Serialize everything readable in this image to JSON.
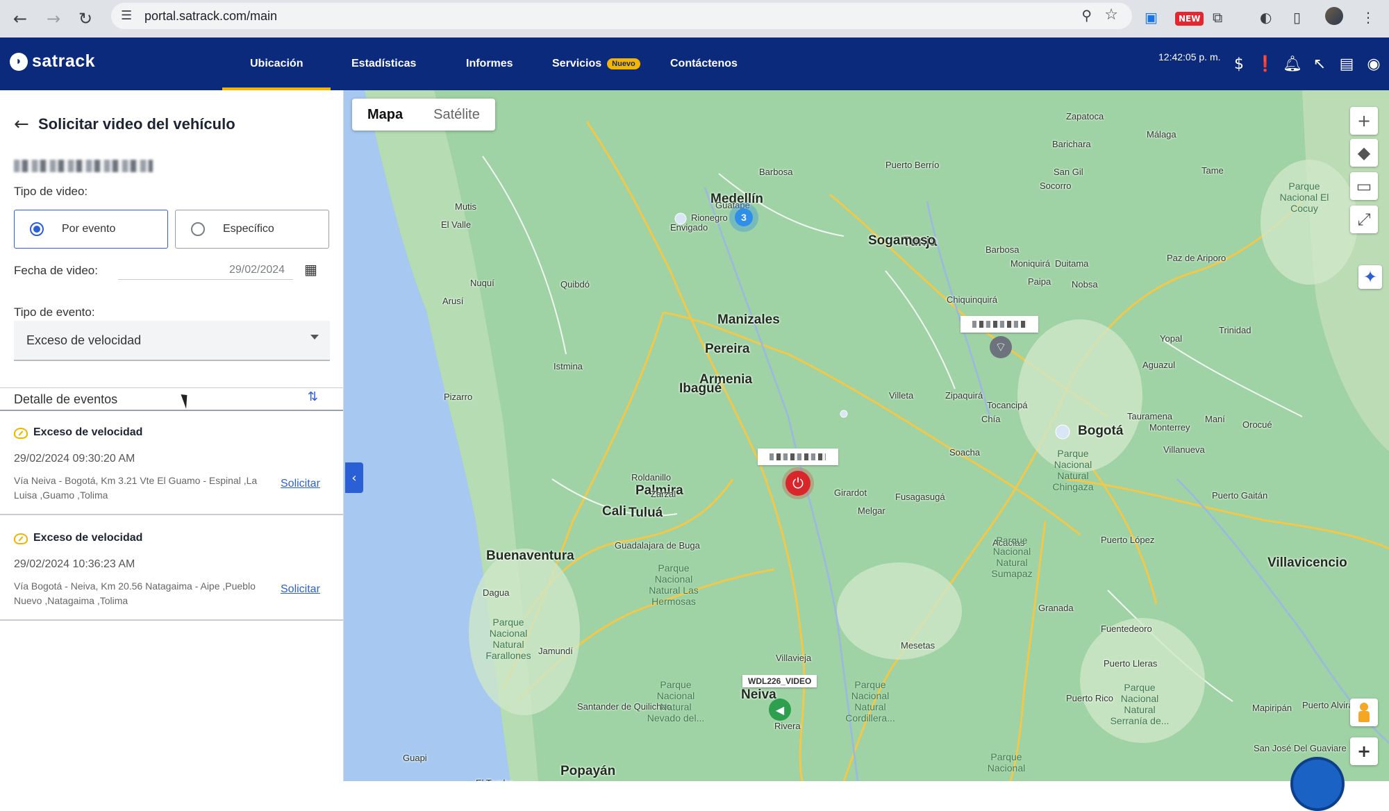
{
  "browser": {
    "url": "portal.satrack.com/main",
    "new_badge": "NEW"
  },
  "app": {
    "logo": "satrack",
    "menu": [
      {
        "label": "Ubicación"
      },
      {
        "label": "Estadísticas"
      },
      {
        "label": "Informes"
      },
      {
        "label": "Servicios",
        "badge": "Nuevo"
      },
      {
        "label": "Contáctenos"
      }
    ],
    "clock": "12:42:05 p. m.",
    "accent": "#f5b400",
    "header_color": "#0b2a7c"
  },
  "panel": {
    "title": "Solicitar video del vehículo",
    "video_type_label": "Tipo de video:",
    "option_event": "Por evento",
    "option_specific": "Específico",
    "date_label": "Fecha de video:",
    "date_value": "29/02/2024",
    "event_type_label": "Tipo de evento:",
    "event_type_value": "Exceso de velocidad",
    "details_title": "Detalle de eventos",
    "events": [
      {
        "name": "Exceso de velocidad",
        "datetime": "29/02/2024 09:30:20 AM",
        "address": "Vía Neiva - Bogotá, Km 3.21 Vte El Guamo - Espinal ,La Luisa ,Guamo ,Tolima",
        "action": "Solicitar"
      },
      {
        "name": "Exceso de velocidad",
        "datetime": "29/02/2024 10:36:23 AM",
        "address": "Vía Bogotá - Neiva, Km 20.56 Natagaima - Aipe ,Pueblo Nuevo ,Natagaima ,Tolima",
        "action": "Solicitar"
      }
    ]
  },
  "map": {
    "type_map": "Mapa",
    "type_satellite": "Satélite",
    "cluster_count": "3",
    "vehicle_label_green": "WDL226_VIDEO",
    "cities": [
      {
        "name": "Medellín",
        "size": "big"
      },
      {
        "name": "Bogotá",
        "size": "big"
      },
      {
        "name": "Manizales",
        "size": "big"
      },
      {
        "name": "Pereira",
        "size": "big"
      },
      {
        "name": "Armenia",
        "size": "big"
      },
      {
        "name": "Ibagué",
        "size": "big"
      },
      {
        "name": "Tunja",
        "size": "big"
      },
      {
        "name": "Sogamoso",
        "size": "big"
      },
      {
        "name": "Villavicencio",
        "size": "big"
      },
      {
        "name": "Cali",
        "size": "big"
      },
      {
        "name": "Tuluá",
        "size": "big"
      },
      {
        "name": "Buenaventura",
        "size": "big"
      },
      {
        "name": "Palmira",
        "size": "big"
      },
      {
        "name": "Neiva",
        "size": "big"
      },
      {
        "name": "Popayán",
        "size": "big"
      },
      {
        "name": "Envigado",
        "size": "small"
      },
      {
        "name": "Rionegro",
        "size": "small"
      },
      {
        "name": "Guatape",
        "size": "small"
      },
      {
        "name": "Barbosa",
        "size": "small"
      },
      {
        "name": "Puerto Berrío",
        "size": "small"
      },
      {
        "name": "Zapatoca",
        "size": "small"
      },
      {
        "name": "Barichara",
        "size": "small"
      },
      {
        "name": "San Gil",
        "size": "small"
      },
      {
        "name": "Socorro",
        "size": "small"
      },
      {
        "name": "Málaga",
        "size": "small"
      },
      {
        "name": "Tame",
        "size": "small"
      },
      {
        "name": "Barbosa",
        "size": "small"
      },
      {
        "name": "Moniquirá",
        "size": "small"
      },
      {
        "name": "Duitama",
        "size": "small"
      },
      {
        "name": "Paipa",
        "size": "small"
      },
      {
        "name": "Nobsa",
        "size": "small"
      },
      {
        "name": "Paz de Ariporo",
        "size": "small"
      },
      {
        "name": "Chiquinquirá",
        "size": "small"
      },
      {
        "name": "Yopal",
        "size": "small"
      },
      {
        "name": "Aguazul",
        "size": "small"
      },
      {
        "name": "Trinidad",
        "size": "small"
      },
      {
        "name": "Mutis",
        "size": "small"
      },
      {
        "name": "El Valle",
        "size": "small"
      },
      {
        "name": "Nuquí",
        "size": "small"
      },
      {
        "name": "Quibdó",
        "size": "small"
      },
      {
        "name": "Arusí",
        "size": "small"
      },
      {
        "name": "Istmina",
        "size": "small"
      },
      {
        "name": "Pizarro",
        "size": "small"
      },
      {
        "name": "Villeta",
        "size": "small"
      },
      {
        "name": "Zipaquirá",
        "size": "small"
      },
      {
        "name": "Tocancipá",
        "size": "small"
      },
      {
        "name": "Tauramena",
        "size": "small"
      },
      {
        "name": "Chía",
        "size": "small"
      },
      {
        "name": "Monterrey",
        "size": "small"
      },
      {
        "name": "Maní",
        "size": "small"
      },
      {
        "name": "Orocué",
        "size": "small"
      },
      {
        "name": "Soacha",
        "size": "small"
      },
      {
        "name": "Villanueva",
        "size": "small"
      },
      {
        "name": "Roldanillo",
        "size": "small"
      },
      {
        "name": "Zarzal",
        "size": "small"
      },
      {
        "name": "Girardot",
        "size": "small"
      },
      {
        "name": "Fusagasugá",
        "size": "small"
      },
      {
        "name": "Melgar",
        "size": "small"
      },
      {
        "name": "Puerto Gaitán",
        "size": "small"
      },
      {
        "name": "Acacías",
        "size": "small"
      },
      {
        "name": "Puerto López",
        "size": "small"
      },
      {
        "name": "Guadalajara de Buga",
        "size": "small"
      },
      {
        "name": "Dagua",
        "size": "small"
      },
      {
        "name": "Jamundí",
        "size": "small"
      },
      {
        "name": "Granada",
        "size": "small"
      },
      {
        "name": "Mesetas",
        "size": "small"
      },
      {
        "name": "Fuentedeoro",
        "size": "small"
      },
      {
        "name": "Puerto Lleras",
        "size": "small"
      },
      {
        "name": "Villavieja",
        "size": "small"
      },
      {
        "name": "Puerto Rico",
        "size": "small"
      },
      {
        "name": "Santander de Quilichao",
        "size": "small"
      },
      {
        "name": "Rivera",
        "size": "small"
      },
      {
        "name": "Mapiripán",
        "size": "small"
      },
      {
        "name": "Puerto Alvira",
        "size": "small"
      },
      {
        "name": "San José Del Guaviare",
        "size": "small"
      },
      {
        "name": "Guapi",
        "size": "small"
      },
      {
        "name": "El Tambo",
        "size": "small"
      }
    ],
    "parks": [
      "Parque Nacional El Cocuy",
      "Parque Nacional Natural Chingaza",
      "Parque Nacional Natural Sumapaz",
      "Parque Nacional Natural Las Hermosas",
      "Parque Nacional Natural Farallones",
      "Parque Nacional Natural Nevado del...",
      "Parque Nacional Natural Cordillera...",
      "Parque Nacional Natural Serranía de...",
      "Parque Nacional"
    ]
  }
}
